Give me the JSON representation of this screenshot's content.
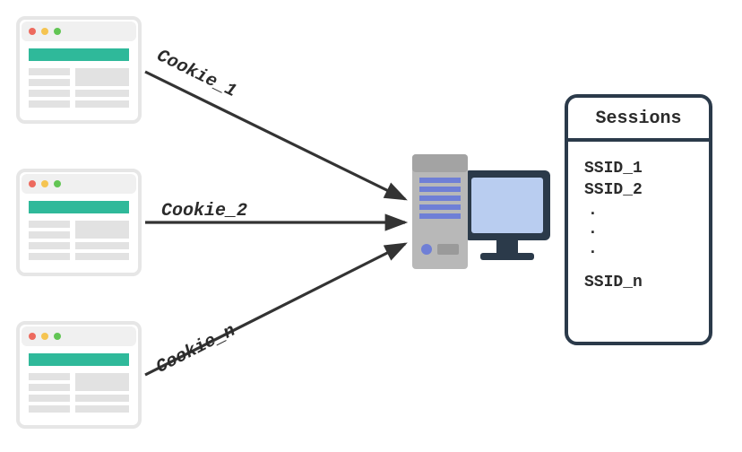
{
  "arrows": [
    {
      "label": "Cookie_1"
    },
    {
      "label": "Cookie_2"
    },
    {
      "label": "Cookie_n"
    }
  ],
  "sessions": {
    "title": "Sessions",
    "items": [
      "SSID_1",
      "SSID_2",
      ".",
      ".",
      ".",
      "SSID_n"
    ]
  }
}
